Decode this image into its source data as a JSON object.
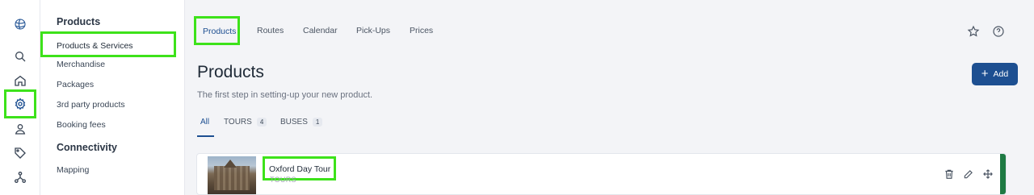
{
  "rail": {
    "items": [
      {
        "name": "logo-icon"
      },
      {
        "name": "search-icon"
      },
      {
        "name": "home-icon"
      },
      {
        "name": "settings-icon",
        "active": true
      },
      {
        "name": "user-pin-icon"
      },
      {
        "name": "tag-icon"
      },
      {
        "name": "network-icon"
      }
    ]
  },
  "subnav": {
    "section1": "Products",
    "items1": [
      "Products & Services",
      "Merchandise",
      "Packages",
      "3rd party products",
      "Booking fees"
    ],
    "selected": "Products & Services",
    "section2": "Connectivity",
    "items2": [
      "Mapping"
    ]
  },
  "topbar": {
    "tabs": [
      "Products",
      "Routes",
      "Calendar",
      "Pick-Ups",
      "Prices"
    ],
    "active_tab": "Products",
    "icons": [
      "star-icon",
      "help-icon"
    ]
  },
  "page": {
    "title": "Products",
    "subtitle": "The first step in setting-up your new product.",
    "add_label": "Add"
  },
  "filters": [
    {
      "label": "All",
      "count": null,
      "active": true
    },
    {
      "label": "TOURS",
      "count": "4"
    },
    {
      "label": "BUSES",
      "count": "1"
    }
  ],
  "products": [
    {
      "title": "Oxford Day Tour",
      "type": "TOURS",
      "status_color": "#1e7a43",
      "actions": [
        "trash-icon",
        "edit-icon",
        "move-icon"
      ]
    }
  ],
  "colors": {
    "accent": "#1d4f91",
    "highlight": "#3de21a",
    "status": "#1e7a43"
  }
}
